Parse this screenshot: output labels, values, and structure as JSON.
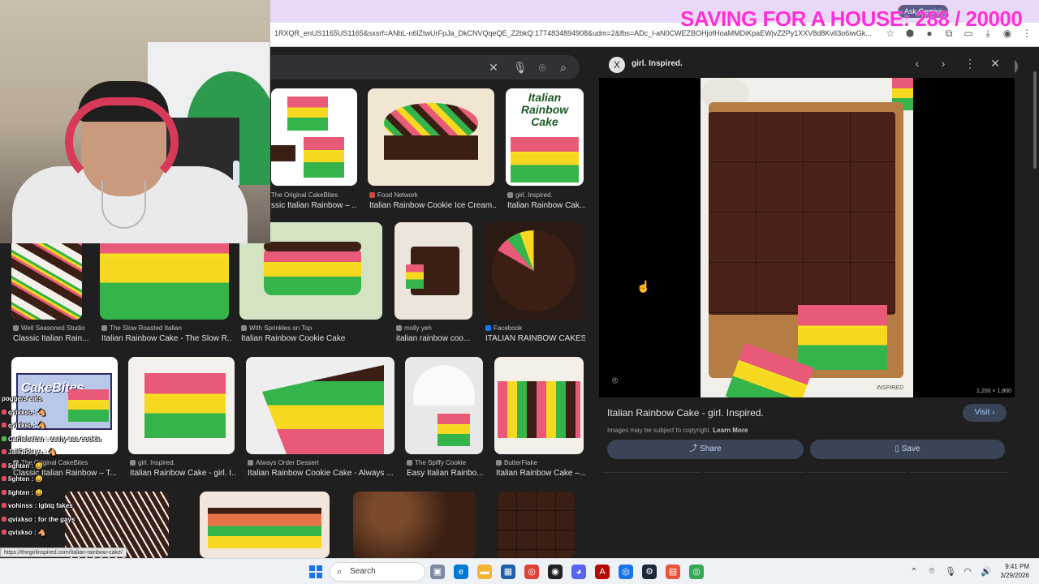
{
  "browser": {
    "url": "1RXQR_enUS1165US1165&sxsrf=ANbL-n6lZtwUrFpJa_DkCNVQqeQE_Z2bkQ:1774834894908&udm=2&fbs=ADc_l-aN0CWEZBOHjofHoaMMDiKpaEWjvZ2Py1XXV8d8KvlI3o6iwGk...",
    "ask_gemini": "Ask Gemini",
    "status_url": "https://thegirlinspired.com/italian-rainbow-cake/"
  },
  "overlay": {
    "title": "SAVING FOR A HOUSE: 288 / 20000"
  },
  "search": {
    "icons": [
      "close-icon",
      "mic-icon",
      "lens-icon",
      "search-icon"
    ]
  },
  "results": [
    {
      "source": "The Original CakeBites",
      "title": "ssic Italian Rainbow – ..."
    },
    {
      "source": "Food Network",
      "title": "Italian Rainbow Cookie Ice Cream..."
    },
    {
      "source": "girl. Inspired.",
      "title": "Italian Rainbow Cak..."
    },
    {
      "source": "Well Seasoned Studio",
      "title": "Classic Italian Rain..."
    },
    {
      "source": "The Slow Roasted Italian",
      "title": "Italian Rainbow Cake - The Slow R..."
    },
    {
      "source": "With Sprinkles on Top",
      "title": "Italian Rainbow Cookie Cake"
    },
    {
      "source": "molly yeh",
      "title": "italian rainbow coo..."
    },
    {
      "source": "Facebook",
      "title": "ITALIAN RAINBOW CAKES..."
    },
    {
      "source": "The Original CakeBites",
      "title": "Classic Italian Rainbow – T..."
    },
    {
      "source": "girl. Inspired.",
      "title": "Italian Rainbow Cake - girl. I..."
    },
    {
      "source": "Always Order Dessert",
      "title": "Italian Rainbow Cookie Cake - Always ..."
    },
    {
      "source": "The Spiffy Cookie",
      "title": "Easy Italian Rainbo..."
    },
    {
      "source": "ButterFlake",
      "title": "Italian Rainbow Cake –..."
    }
  ],
  "tile_labels": {
    "italian_cake_logo": "Italian Rainbow Cake",
    "cakebites_box": "CakeBites"
  },
  "panel": {
    "source": "girl. Inspired.",
    "logo_letter": "X",
    "dimensions": "1,200 × 1,800",
    "title": "Italian Rainbow Cake - girl. Inspired.",
    "visit": "Visit",
    "copyright": "Images may be subject to copyright.",
    "learn_more": "Learn More",
    "share": "Share",
    "save": "Save",
    "watermark": "INSPIRED"
  },
  "chat": [
    {
      "name": "",
      "msg": "poggers eats"
    },
    {
      "name": "qvixkso",
      "msg": ": 🐴"
    },
    {
      "name": "qvixkso",
      "msg": ": 🐴"
    },
    {
      "name": "Carlisbetter",
      "msg": ": zesty ass cookie"
    },
    {
      "name": "JailRtPlaya",
      "msg": ": 🐴"
    },
    {
      "name": "lighten",
      "msg": ": 😀"
    },
    {
      "name": "lighten",
      "msg": ": 😀"
    },
    {
      "name": "lighten",
      "msg": ": 😀"
    },
    {
      "name": "vohinss",
      "msg": ": lgbtq fakes"
    },
    {
      "name": "qvixkso",
      "msg": ": for the gays"
    },
    {
      "name": "qvixkso",
      "msg": ": 🐴"
    }
  ],
  "taskbar": {
    "search": "Search",
    "time": "9:41 PM",
    "date": "3/29/2026"
  },
  "colors": {
    "overlay_pink": "#ff2ed8",
    "page_bg": "#1f1f1f",
    "button_bg": "#394457",
    "cake_pink": "#e85a78",
    "cake_yellow": "#f7d820",
    "cake_green": "#34b44a",
    "chocolate": "#3b1f15"
  }
}
